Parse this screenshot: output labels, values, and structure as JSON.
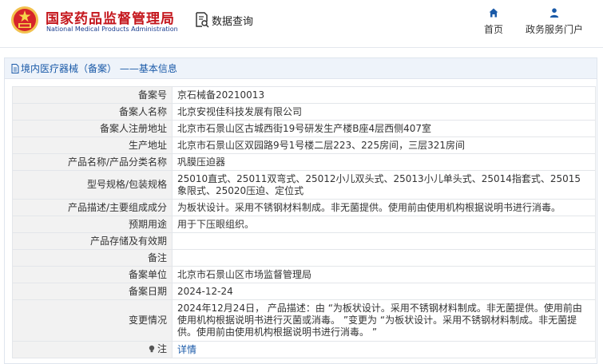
{
  "header": {
    "logo_cn": "国家药品监督管理局",
    "logo_en": "National Medical Products Administration",
    "emblem_icon": "national-emblem-icon",
    "data_query": "数据查询",
    "nav": [
      {
        "label": "首页",
        "icon": "home-icon"
      },
      {
        "label": "政务服务门户",
        "icon": "user-icon"
      }
    ]
  },
  "panel": {
    "title": "境内医疗器械（备案） ——基本信息"
  },
  "rows": [
    {
      "label": "备案号",
      "value": "京石械备20210013"
    },
    {
      "label": "备案人名称",
      "value": "北京安视佳科技发展有限公司"
    },
    {
      "label": "备案人注册地址",
      "value": "北京市石景山区古城西街19号研发生产楼B座4层西侧407室"
    },
    {
      "label": "生产地址",
      "value": "北京市石景山区双园路9号1号楼二层223、225房间，三层321房间"
    },
    {
      "label": "产品名称/产品分类名称",
      "value": "巩膜压迫器"
    },
    {
      "label": "型号规格/包装规格",
      "value": "25010直式、25011双弯式、25012小儿双头式、25013小儿单头式、25014指套式、25015象限式、25020压迫、定位式"
    },
    {
      "label": "产品描述/主要组成成分",
      "value": "为板状设计。采用不锈钢材料制成。非无菌提供。使用前由使用机构根据说明书进行消毒。"
    },
    {
      "label": "预期用途",
      "value": "用于下压眼组织。"
    },
    {
      "label": "产品存储及有效期",
      "value": ""
    },
    {
      "label": "备注",
      "value": ""
    },
    {
      "label": "备案单位",
      "value": "北京市石景山区市场监督管理局"
    },
    {
      "label": "备案日期",
      "value": "2024-12-24"
    },
    {
      "label": "变更情况",
      "value": "2024年12月24日， 产品描述：由 “为板状设计。采用不锈钢材料制成。非无菌提供。使用前由使用机构根据说明书进行灭菌或消毒。 ”变更为 “为板状设计。采用不锈钢材料制成。非无菌提供。使用前由使用机构根据说明书进行消毒。 ”"
    },
    {
      "label": "注",
      "value": "详情",
      "icon": "bulb-icon"
    }
  ]
}
